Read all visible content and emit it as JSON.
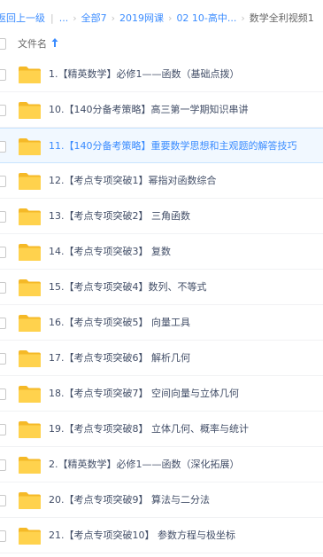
{
  "breadcrumb": {
    "back_label": "返回上一级",
    "ellipsis_label": "...",
    "items": [
      {
        "label": "全部7"
      },
      {
        "label": "2019网课"
      },
      {
        "label": "02 10-高中..."
      }
    ],
    "current_label": "数学全利视频1",
    "link_color": "#3b8cff"
  },
  "header": {
    "column_label": "文件名",
    "sort_icon": "arrow-up-icon"
  },
  "folder_icon": {
    "name": "folder-icon",
    "color": "#ffd24d"
  },
  "files": [
    {
      "name": "1.【精英数学】必修1——函数（基础点拨）",
      "selected": false
    },
    {
      "name": "10.【140分备考策略】高三第一学期知识串讲",
      "selected": false
    },
    {
      "name": "11.【140分备考策略】重要数学思想和主观题的解答技巧",
      "selected": true
    },
    {
      "name": "12.【考点专项突破1】幂指对函数综合",
      "selected": false
    },
    {
      "name": "13.【考点专项突破2】 三角函数",
      "selected": false
    },
    {
      "name": "14.【考点专项突破3】 复数",
      "selected": false
    },
    {
      "name": "15.【考点专项突破4】数列、不等式",
      "selected": false
    },
    {
      "name": "16.【考点专项突破5】 向量工具",
      "selected": false
    },
    {
      "name": "17.【考点专项突破6】 解析几何",
      "selected": false
    },
    {
      "name": "18.【考点专项突破7】 空间向量与立体几何",
      "selected": false
    },
    {
      "name": "19.【考点专项突破8】 立体几何、概率与统计",
      "selected": false
    },
    {
      "name": "2.【精英数学】必修1——函数（深化拓展）",
      "selected": false
    },
    {
      "name": "20.【考点专项突破9】 算法与二分法",
      "selected": false
    },
    {
      "name": "21.【考点专项突破10】 参数方程与极坐标",
      "selected": false
    }
  ]
}
